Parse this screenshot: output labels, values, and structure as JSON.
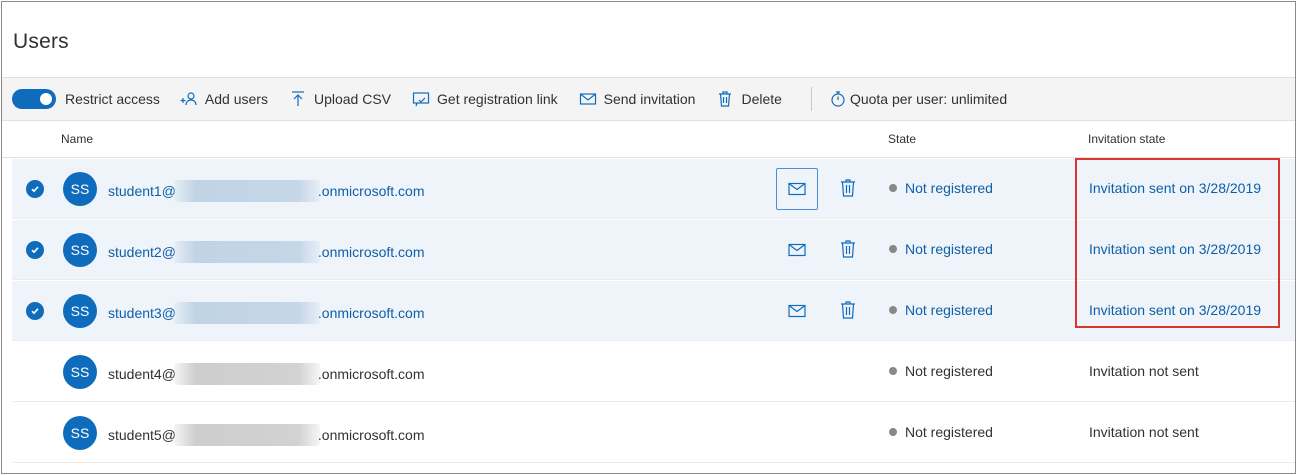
{
  "page": {
    "title": "Users"
  },
  "toolbar": {
    "restrict_access": "Restrict access",
    "add_users": "Add users",
    "upload_csv": "Upload CSV",
    "get_registration_link": "Get registration link",
    "send_invitation": "Send invitation",
    "delete": "Delete",
    "quota": "Quota per user: unlimited"
  },
  "table": {
    "columns": {
      "name": "Name",
      "state": "State",
      "invitation_state": "Invitation state"
    },
    "rows": [
      {
        "initials": "SS",
        "email_prefix": "student1@",
        "email_suffix": ".onmicrosoft.com",
        "state": "Not registered",
        "invitation": "Invitation sent on 3/28/2019",
        "selected": true
      },
      {
        "initials": "SS",
        "email_prefix": "student2@",
        "email_suffix": ".onmicrosoft.com",
        "state": "Not registered",
        "invitation": "Invitation sent on 3/28/2019",
        "selected": true
      },
      {
        "initials": "SS",
        "email_prefix": "student3@",
        "email_suffix": ".onmicrosoft.com",
        "state": "Not registered",
        "invitation": "Invitation sent on 3/28/2019",
        "selected": true
      },
      {
        "initials": "SS",
        "email_prefix": "student4@",
        "email_suffix": ".onmicrosoft.com",
        "state": "Not registered",
        "invitation": "Invitation not sent",
        "selected": false
      },
      {
        "initials": "SS",
        "email_prefix": "student5@",
        "email_suffix": ".onmicrosoft.com",
        "state": "Not registered",
        "invitation": "Invitation not sent",
        "selected": false
      }
    ]
  },
  "colors": {
    "accent": "#0f6cbd",
    "highlight": "#d9362f",
    "selected_row": "#eef4fa"
  }
}
